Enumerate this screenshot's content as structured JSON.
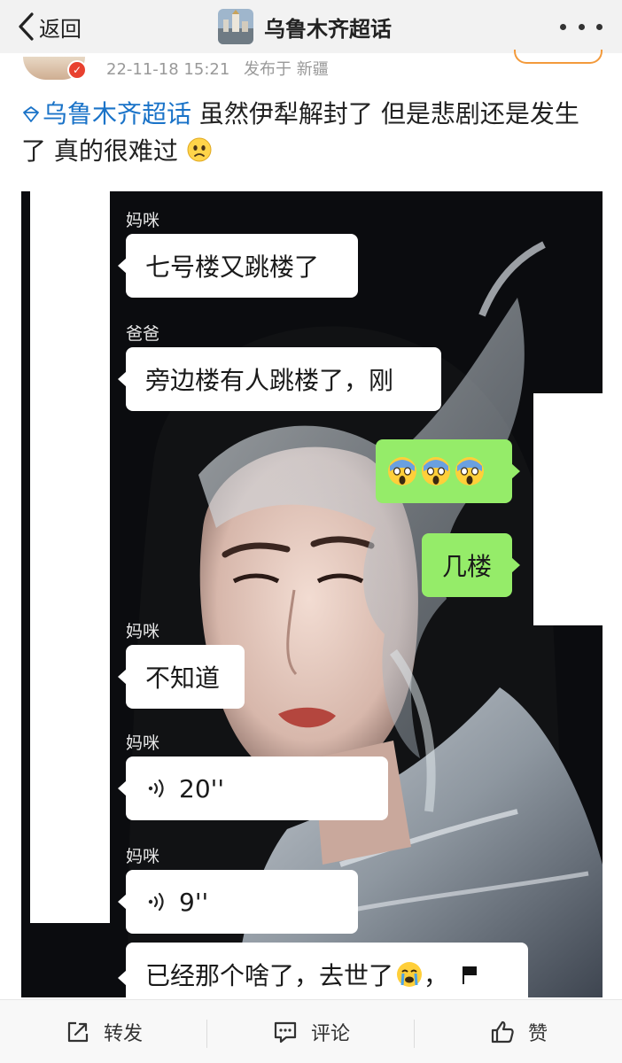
{
  "nav": {
    "back_label": "返回",
    "title": "乌鲁木齐超话"
  },
  "post": {
    "timestamp": "22-11-18 15:21",
    "location": "发布于 新疆",
    "topic": "乌鲁木齐超话",
    "text": " 虽然伊犁解封了 但是悲剧还是发生了 真的很难过"
  },
  "chat": {
    "messages": [
      {
        "sender": "妈咪",
        "text": "七号楼又跳楼了"
      },
      {
        "sender": "爸爸",
        "text": "旁边楼有人跳楼了，刚"
      },
      {
        "sender": "me",
        "emoji": "screaming-face x3"
      },
      {
        "sender": "me",
        "text": "几楼"
      },
      {
        "sender": "妈咪",
        "text": "不知道"
      },
      {
        "sender": "妈咪",
        "voice": "20''"
      },
      {
        "sender": "妈咪",
        "voice": "9''"
      },
      {
        "sender": "",
        "text": "已经那个啥了，去世了"
      }
    ]
  },
  "bottom": {
    "repost": "转发",
    "comment": "评论",
    "like": "赞"
  },
  "colors": {
    "topic_link": "#1a73c8",
    "wechat_green": "#95ec69",
    "badge_red": "#e8412f"
  }
}
